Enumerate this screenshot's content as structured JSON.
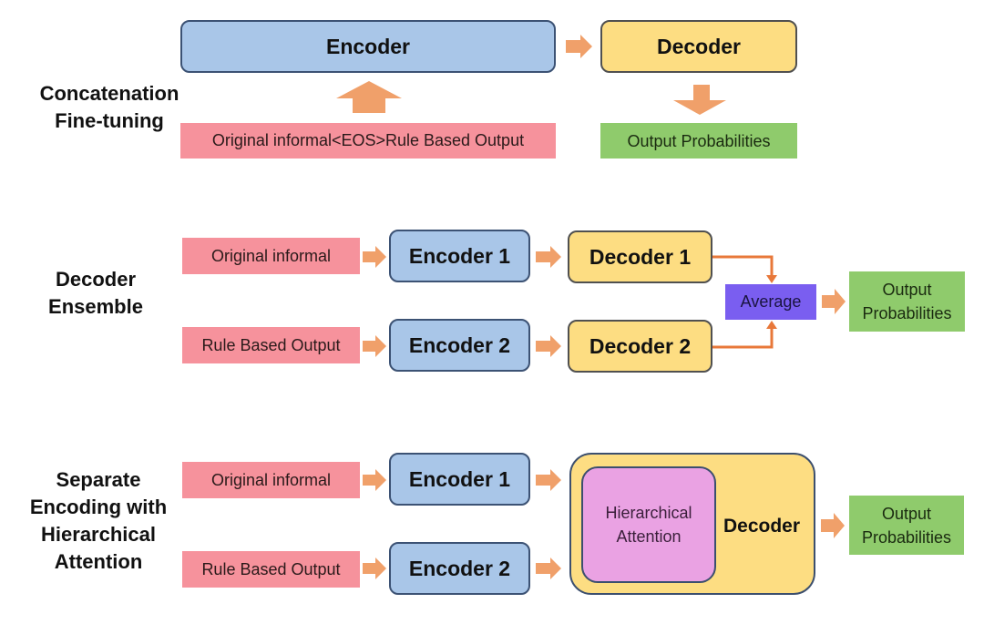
{
  "colors": {
    "encoder_fill": "#a9c6e8",
    "decoder_fill": "#fddd82",
    "input_fill": "#f6929c",
    "output_fill": "#8fcb6c",
    "average_fill": "#7a5ef0",
    "attention_fill": "#eaa2e3",
    "arrow": "#f0a06a",
    "connector": "#e8783a"
  },
  "sections": {
    "concat": {
      "label_line1": "Concatenation",
      "label_line2": "Fine-tuning",
      "encoder": "Encoder",
      "decoder": "Decoder",
      "input": "Original informal<EOS>Rule Based Output",
      "output": "Output Probabilities"
    },
    "ensemble": {
      "label_line1": "Decoder",
      "label_line2": "Ensemble",
      "input1": "Original informal",
      "input2": "Rule Based Output",
      "encoder1": "Encoder 1",
      "encoder2": "Encoder 2",
      "decoder1": "Decoder 1",
      "decoder2": "Decoder 2",
      "average": "Average",
      "output_line1": "Output",
      "output_line2": "Probabilities"
    },
    "hierarchical": {
      "label_line1": "Separate",
      "label_line2": "Encoding with",
      "label_line3": "Hierarchical",
      "label_line4": "Attention",
      "input1": "Original informal",
      "input2": "Rule Based Output",
      "encoder1": "Encoder 1",
      "encoder2": "Encoder 2",
      "attention_line1": "Hierarchical",
      "attention_line2": "Attention",
      "decoder": "Decoder",
      "output_line1": "Output",
      "output_line2": "Probabilities"
    }
  }
}
